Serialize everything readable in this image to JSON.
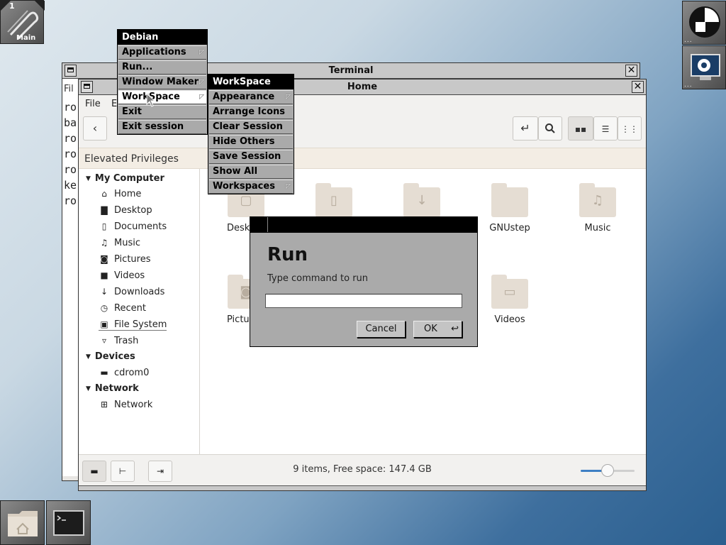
{
  "clip": {
    "number": "1",
    "label": "Main"
  },
  "terminal": {
    "title": "Terminal",
    "menu_fragment": "Fil",
    "lines": [
      "ro",
      "ba",
      "ro",
      "ro",
      "ro",
      "ke",
      "ro"
    ]
  },
  "filemanager": {
    "title": "Home",
    "menus": [
      "File",
      "E"
    ],
    "banner": "Elevated Privileges",
    "sidebar": {
      "sections": [
        {
          "label": "My Computer",
          "items": [
            {
              "label": "Home",
              "icon": "home-icon"
            },
            {
              "label": "Desktop",
              "icon": "desktop-icon"
            },
            {
              "label": "Documents",
              "icon": "document-icon"
            },
            {
              "label": "Music",
              "icon": "music-icon"
            },
            {
              "label": "Pictures",
              "icon": "camera-icon"
            },
            {
              "label": "Videos",
              "icon": "video-icon"
            },
            {
              "label": "Downloads",
              "icon": "download-icon"
            },
            {
              "label": "Recent",
              "icon": "clock-icon"
            },
            {
              "label": "File System",
              "icon": "drive-icon"
            },
            {
              "label": "Trash",
              "icon": "trash-icon"
            }
          ]
        },
        {
          "label": "Devices",
          "items": [
            {
              "label": "cdrom0",
              "icon": "cdrom-icon"
            }
          ]
        },
        {
          "label": "Network",
          "items": [
            {
              "label": "Network",
              "icon": "network-icon"
            }
          ]
        }
      ]
    },
    "files": [
      "Desk",
      "GNUstep",
      "Music",
      "Pictu",
      "Videos"
    ],
    "status": "9 items, Free space: 147.4  GB",
    "zoom_fraction": 0.5
  },
  "root_menu": {
    "title": "Debian",
    "items": [
      "Applications",
      "Run...",
      "Window Maker",
      "WorkSpace",
      "Exit",
      "Exit session"
    ]
  },
  "workspace_menu": {
    "title": "WorkSpace",
    "items": [
      "Appearance",
      "Arrange Icons",
      "Clear Session",
      "Hide Others",
      "Save Session",
      "Show All",
      "Workspaces"
    ]
  },
  "run_dialog": {
    "heading": "Run",
    "prompt": "Type command to run",
    "input_value": "",
    "cancel_label": "Cancel",
    "ok_label": "OK"
  }
}
